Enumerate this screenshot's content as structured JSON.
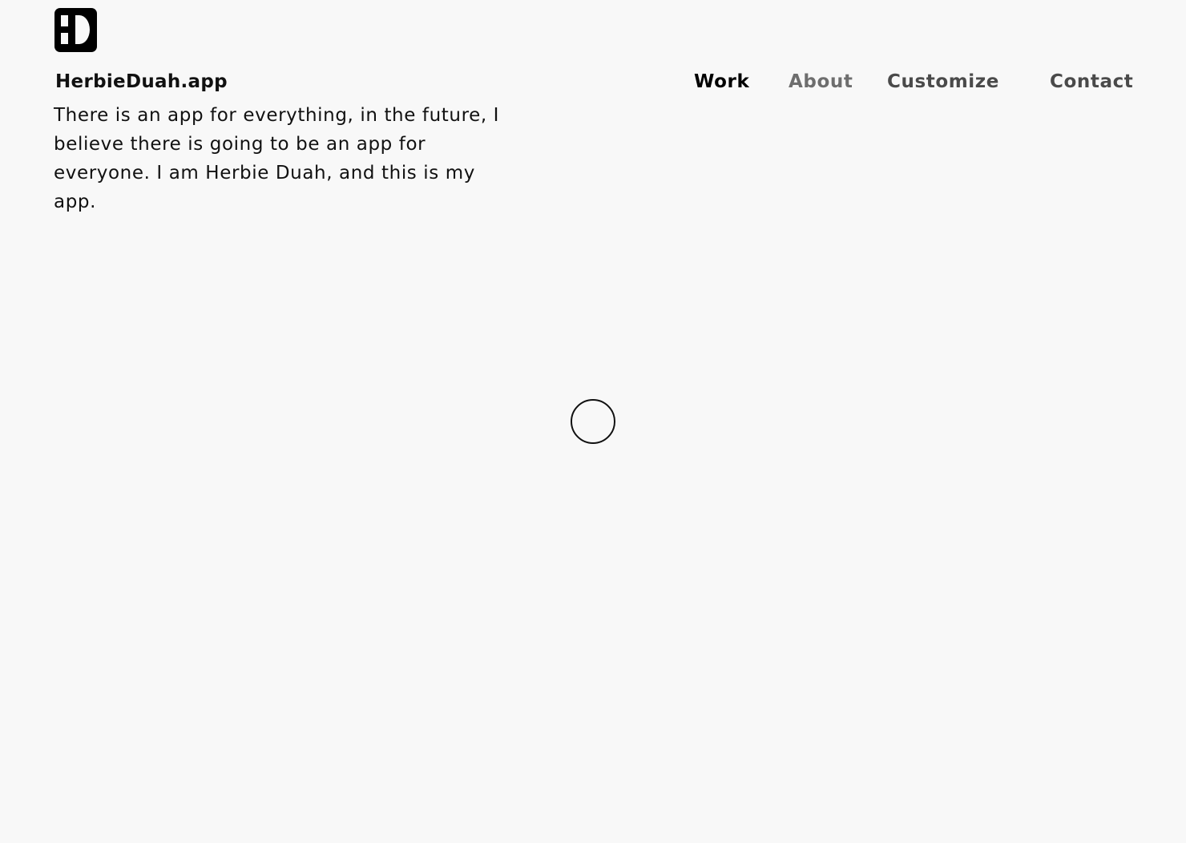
{
  "site": {
    "logo_icon": "hd-monogram-logo-icon",
    "title": "HerbieDuah.app",
    "tagline": "There is an app for everything, in the future, I believe there is going to be an app for everyone. I am Herbie Duah, and this is my app."
  },
  "nav": {
    "items": [
      {
        "label": "Work",
        "active": true
      },
      {
        "label": "About",
        "active": false
      },
      {
        "label": "Customize",
        "active": false
      },
      {
        "label": "Contact",
        "active": false
      }
    ]
  },
  "loader": {
    "icon": "loading-circle-icon"
  },
  "colors": {
    "background": "#f8f8f8",
    "text": "#111111",
    "nav_active": "#000000",
    "nav_inactive": "#4a4a4a"
  }
}
